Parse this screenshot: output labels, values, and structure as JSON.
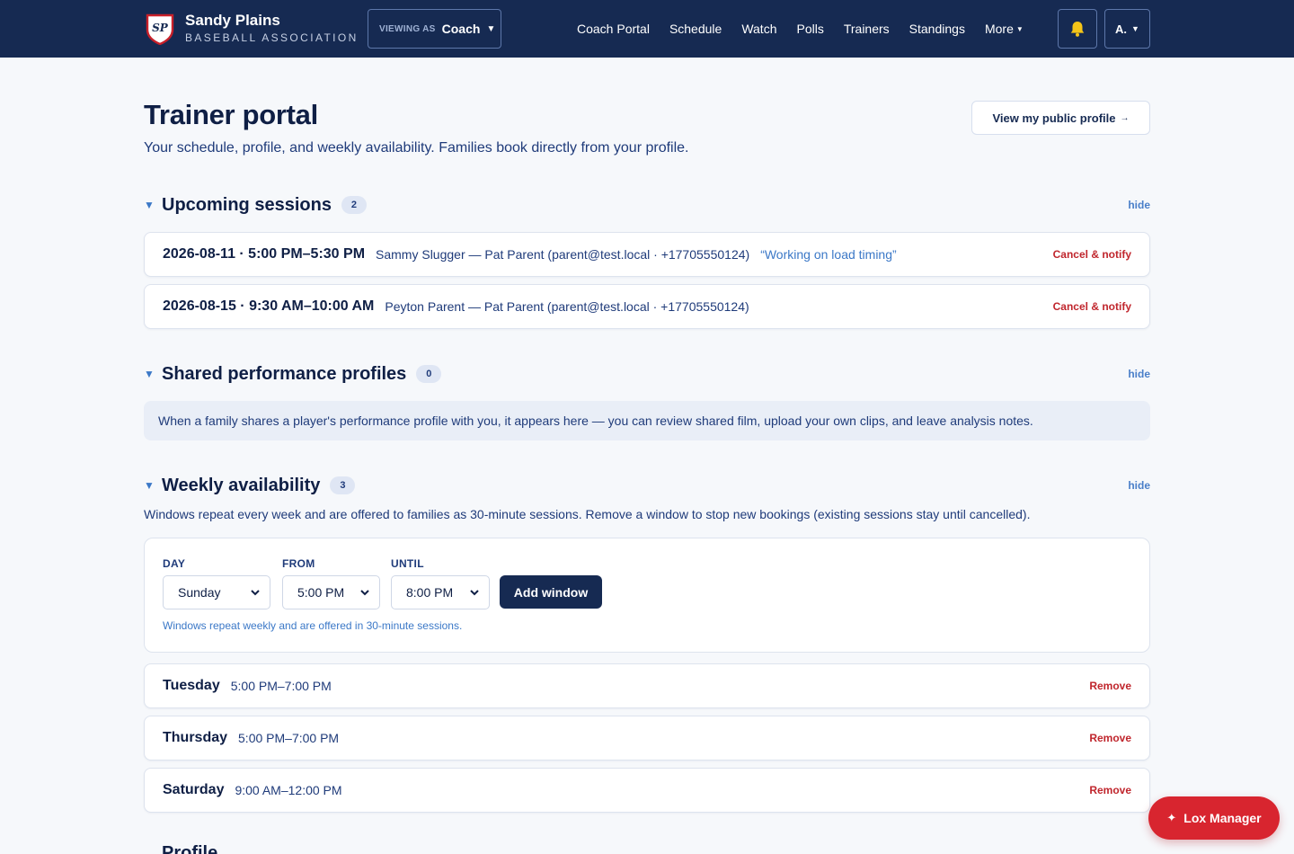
{
  "brand": {
    "initials": "SP",
    "name": "Sandy Plains",
    "sub": "BASEBALL ASSOCIATION"
  },
  "viewing": {
    "label": "VIEWING AS",
    "role": "Coach"
  },
  "nav": [
    {
      "label": "Coach Portal"
    },
    {
      "label": "Schedule"
    },
    {
      "label": "Watch"
    },
    {
      "label": "Polls"
    },
    {
      "label": "Trainers"
    },
    {
      "label": "Standings"
    },
    {
      "label": "More"
    }
  ],
  "account": {
    "initial": "A."
  },
  "page": {
    "title": "Trainer portal",
    "subtitle": "Your schedule, profile, and weekly availability. Families book directly from your profile.",
    "public_profile_button": "View my public profile",
    "public_profile_arrow": "→"
  },
  "upcoming": {
    "title": "Upcoming sessions",
    "count": "2",
    "hide_label": "hide",
    "sessions": [
      {
        "date_time": "2026-08-11 · 5:00 PM–5:30 PM",
        "who": "Sammy Slugger — Pat Parent (parent@test.local · +17705550124)",
        "note": "“Working on load timing”",
        "action": "Cancel & notify"
      },
      {
        "date_time": "2026-08-15 · 9:30 AM–10:00 AM",
        "who": "Peyton Parent — Pat Parent (parent@test.local · +17705550124)",
        "note": "",
        "action": "Cancel & notify"
      }
    ]
  },
  "shared": {
    "title": "Shared performance profiles",
    "count": "0",
    "hide_label": "hide",
    "empty_text": "When a family shares a player's performance profile with you, it appears here — you can review shared film, upload your own clips, and leave analysis notes."
  },
  "availability": {
    "title": "Weekly availability",
    "count": "3",
    "hide_label": "hide",
    "description": "Windows repeat every week and are offered to families as 30-minute sessions. Remove a window to stop new bookings (existing sessions stay until cancelled).",
    "form": {
      "day_label": "DAY",
      "day_value": "Sunday",
      "from_label": "FROM",
      "from_value": "5:00 PM",
      "until_label": "UNTIL",
      "until_value": "8:00 PM",
      "add_button": "Add window",
      "help": "Windows repeat weekly and are offered in 30-minute sessions."
    },
    "windows": [
      {
        "day": "Tuesday",
        "time": "5:00 PM–7:00 PM",
        "action": "Remove"
      },
      {
        "day": "Thursday",
        "time": "5:00 PM–7:00 PM",
        "action": "Remove"
      },
      {
        "day": "Saturday",
        "time": "9:00 AM–12:00 PM",
        "action": "Remove"
      }
    ]
  },
  "next_section_title": "Profile",
  "assistant": {
    "label": "Lox Manager",
    "icon": "sparkle-icon"
  },
  "colors": {
    "navy": "#162a52",
    "accent_blue": "#3b78c7",
    "danger": "#c0262d",
    "fab_red": "#d8252f"
  }
}
